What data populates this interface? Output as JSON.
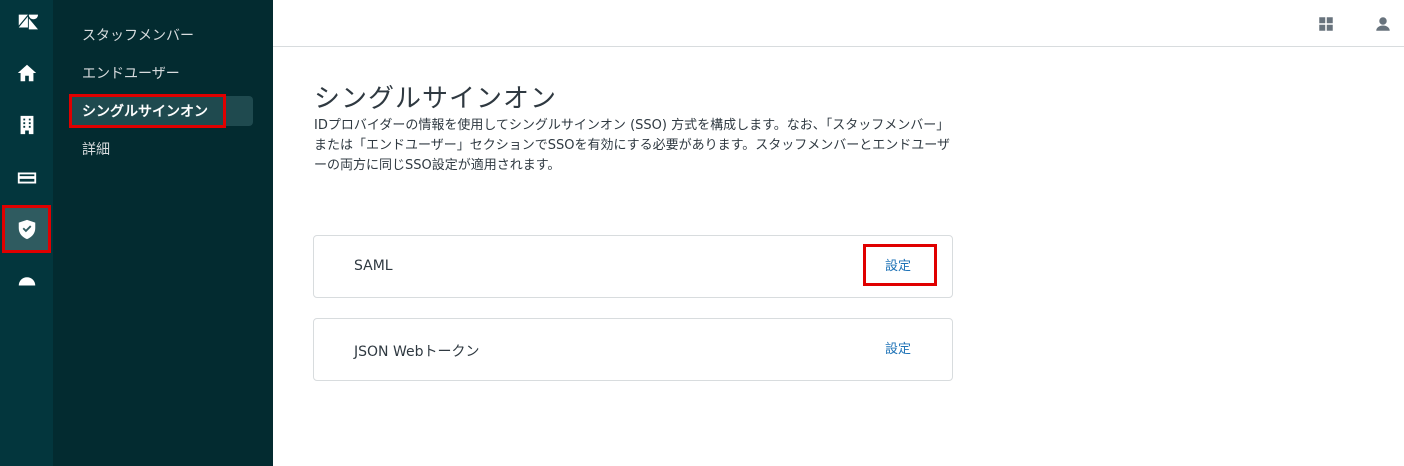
{
  "rail": {
    "items": [
      {
        "icon": "zendesk-logo-icon"
      },
      {
        "icon": "home-icon"
      },
      {
        "icon": "building-icon"
      },
      {
        "icon": "billing-card-icon"
      },
      {
        "icon": "security-shield-icon",
        "active": true
      },
      {
        "icon": "apps-cloud-icon"
      }
    ]
  },
  "subnav": {
    "items": [
      {
        "label": "スタッフメンバー"
      },
      {
        "label": "エンドユーザー"
      },
      {
        "label": "シングルサインオン",
        "active": true
      },
      {
        "label": "詳細"
      }
    ]
  },
  "topbar": {
    "icons": [
      "apps-grid-icon",
      "user-profile-icon"
    ]
  },
  "main": {
    "title": "シングルサインオン",
    "description": "IDプロバイダーの情報を使用してシングルサインオン (SSO) 方式を構成します。なお、「スタッフメンバー」または「エンドユーザー」セクションでSSOを有効にする必要があります。スタッフメンバーとエンドユーザーの両方に同じSSO設定が適用されます。",
    "cards": [
      {
        "label": "SAML",
        "action": "設定"
      },
      {
        "label": "JSON Webトークン",
        "action": "設定"
      }
    ]
  },
  "colors": {
    "rail_bg": "#03363d",
    "subnav_bg": "#032b30",
    "link": "#1f73b7",
    "highlight": "#e00000"
  }
}
